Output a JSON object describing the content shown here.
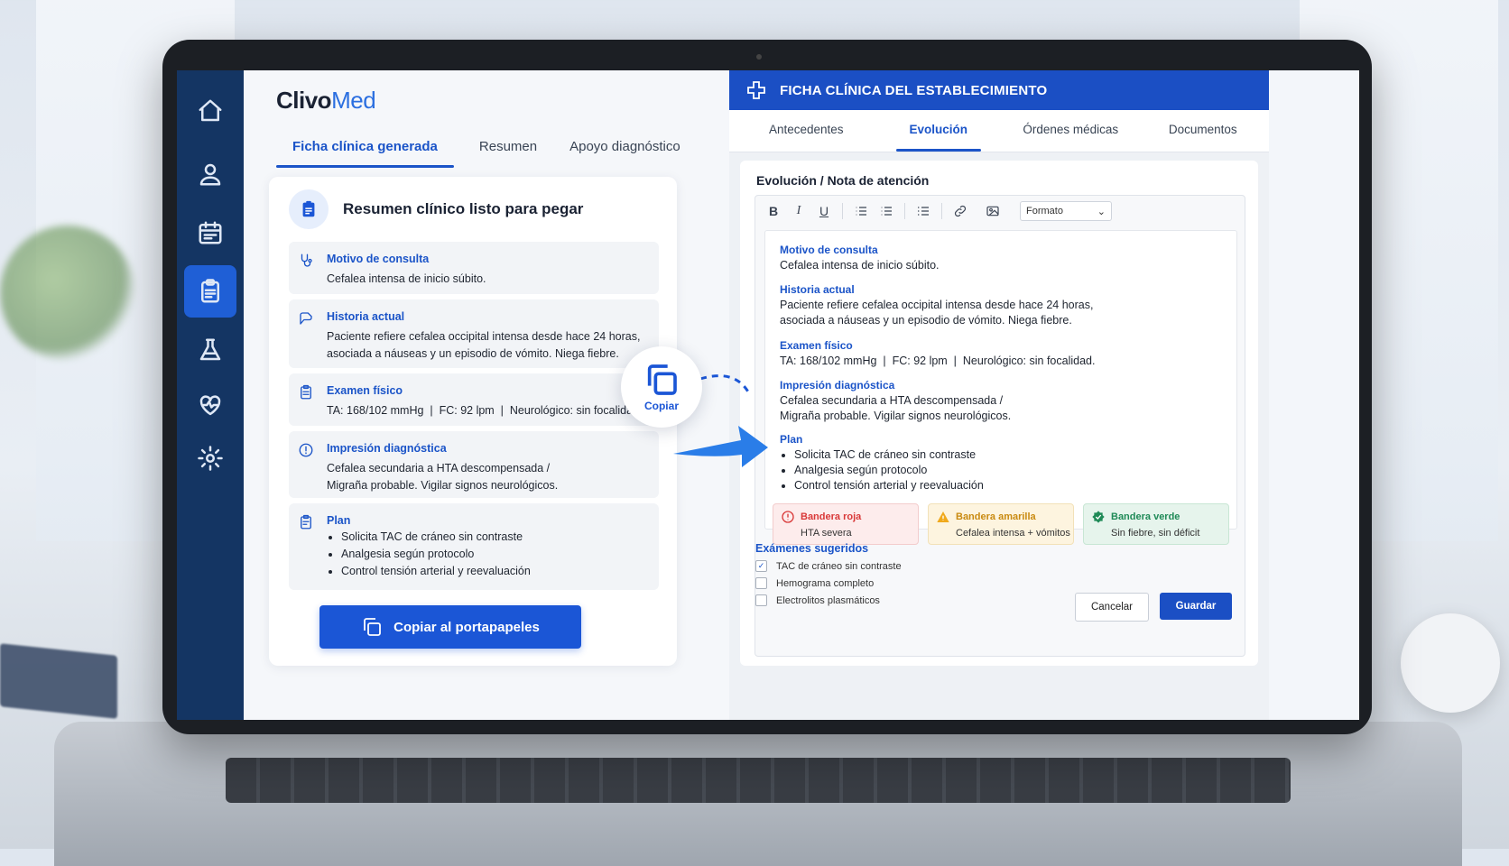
{
  "app": {
    "logo_main": "Clivo",
    "logo_accent": "Med"
  },
  "sidebar": {
    "items": [
      {
        "icon": "home-icon"
      },
      {
        "icon": "user-icon"
      },
      {
        "icon": "calendar-icon"
      },
      {
        "icon": "clipboard-icon",
        "active": true
      },
      {
        "icon": "flask-icon"
      },
      {
        "icon": "heart-pulse-icon"
      },
      {
        "icon": "gear-icon"
      }
    ]
  },
  "left": {
    "tabs": [
      "Ficha clínica generada",
      "Resumen",
      "Apoyo diagnóstico"
    ],
    "card_title": "Resumen clínico listo para pegar",
    "sections": {
      "motivo": {
        "title": "Motivo de consulta",
        "text": "Cefalea intensa de inicio súbito."
      },
      "historia": {
        "title": "Historia actual",
        "line1": "Paciente refiere cefalea occipital intensa desde hace 24 horas,",
        "line2": "asociada a náuseas y un episodio de vómito. Niega fiebre."
      },
      "examen": {
        "title": "Examen físico",
        "text": "TA: 168/102 mmHg  |  FC: 92 lpm  |  Neurológico: sin focalidad."
      },
      "impresion": {
        "title": "Impresión diagnóstica",
        "line1": "Cefalea secundaria a HTA descompensada /",
        "line2": "Migraña probable. Vigilar signos neurológicos."
      },
      "plan": {
        "title": "Plan",
        "items": [
          "Solicita TAC de cráneo sin contraste",
          "Analgesia según protocolo",
          "Control tensión arterial y reevaluación"
        ]
      }
    },
    "copy_button": "Copiar al portapapeles"
  },
  "floating_copy": {
    "label": "Copiar"
  },
  "right": {
    "header_title": "FICHA CLÍNICA DEL ESTABLECIMIENTO",
    "tabs": [
      "Antecedentes",
      "Evolución",
      "Órdenes médicas",
      "Documentos"
    ],
    "card_title": "Evolución / Nota de atención",
    "toolbar": {
      "bold": "B",
      "italic": "I",
      "underline": "U",
      "format_select": "Formato"
    },
    "doc": {
      "motivo": {
        "title": "Motivo de consulta",
        "text": "Cefalea intensa de inicio súbito."
      },
      "historia": {
        "title": "Historia actual",
        "line1": "Paciente refiere cefalea occipital intensa desde hace 24 horas,",
        "line2": "asociada a náuseas y un episodio de vómito. Niega fiebre."
      },
      "examen": {
        "title": "Examen físico",
        "text": "TA: 168/102 mmHg  |  FC: 92 lpm  |  Neurológico: sin focalidad."
      },
      "impresion": {
        "title": "Impresión diagnóstica",
        "line1": "Cefalea secundaria a HTA descompensada /",
        "line2": "Migraña probable. Vigilar signos neurológicos."
      },
      "plan": {
        "title": "Plan",
        "items": [
          "Solicita TAC de cráneo sin contraste",
          "Analgesia según protocolo",
          "Control tensión arterial y reevaluación"
        ]
      }
    },
    "flags": [
      {
        "title": "Bandera roja",
        "text": "HTA severa",
        "color": "#d93838",
        "bg": "#fdecec"
      },
      {
        "title": "Bandera amarilla",
        "text": "Cefalea intensa + vómitos",
        "color": "#d9900f",
        "bg": "#fdf4df"
      },
      {
        "title": "Bandera verde",
        "text": "Sin fiebre, sin déficit",
        "color": "#1f8a57",
        "bg": "#e6f4ec"
      }
    ],
    "exams": {
      "title": "Exámenes sugeridos",
      "items": [
        {
          "label": "TAC de cráneo sin contraste",
          "checked": true
        },
        {
          "label": "Hemograma completo",
          "checked": false
        },
        {
          "label": "Electrolitos plasmáticos",
          "checked": false
        }
      ]
    },
    "cancel": "Cancelar",
    "save": "Guardar"
  }
}
